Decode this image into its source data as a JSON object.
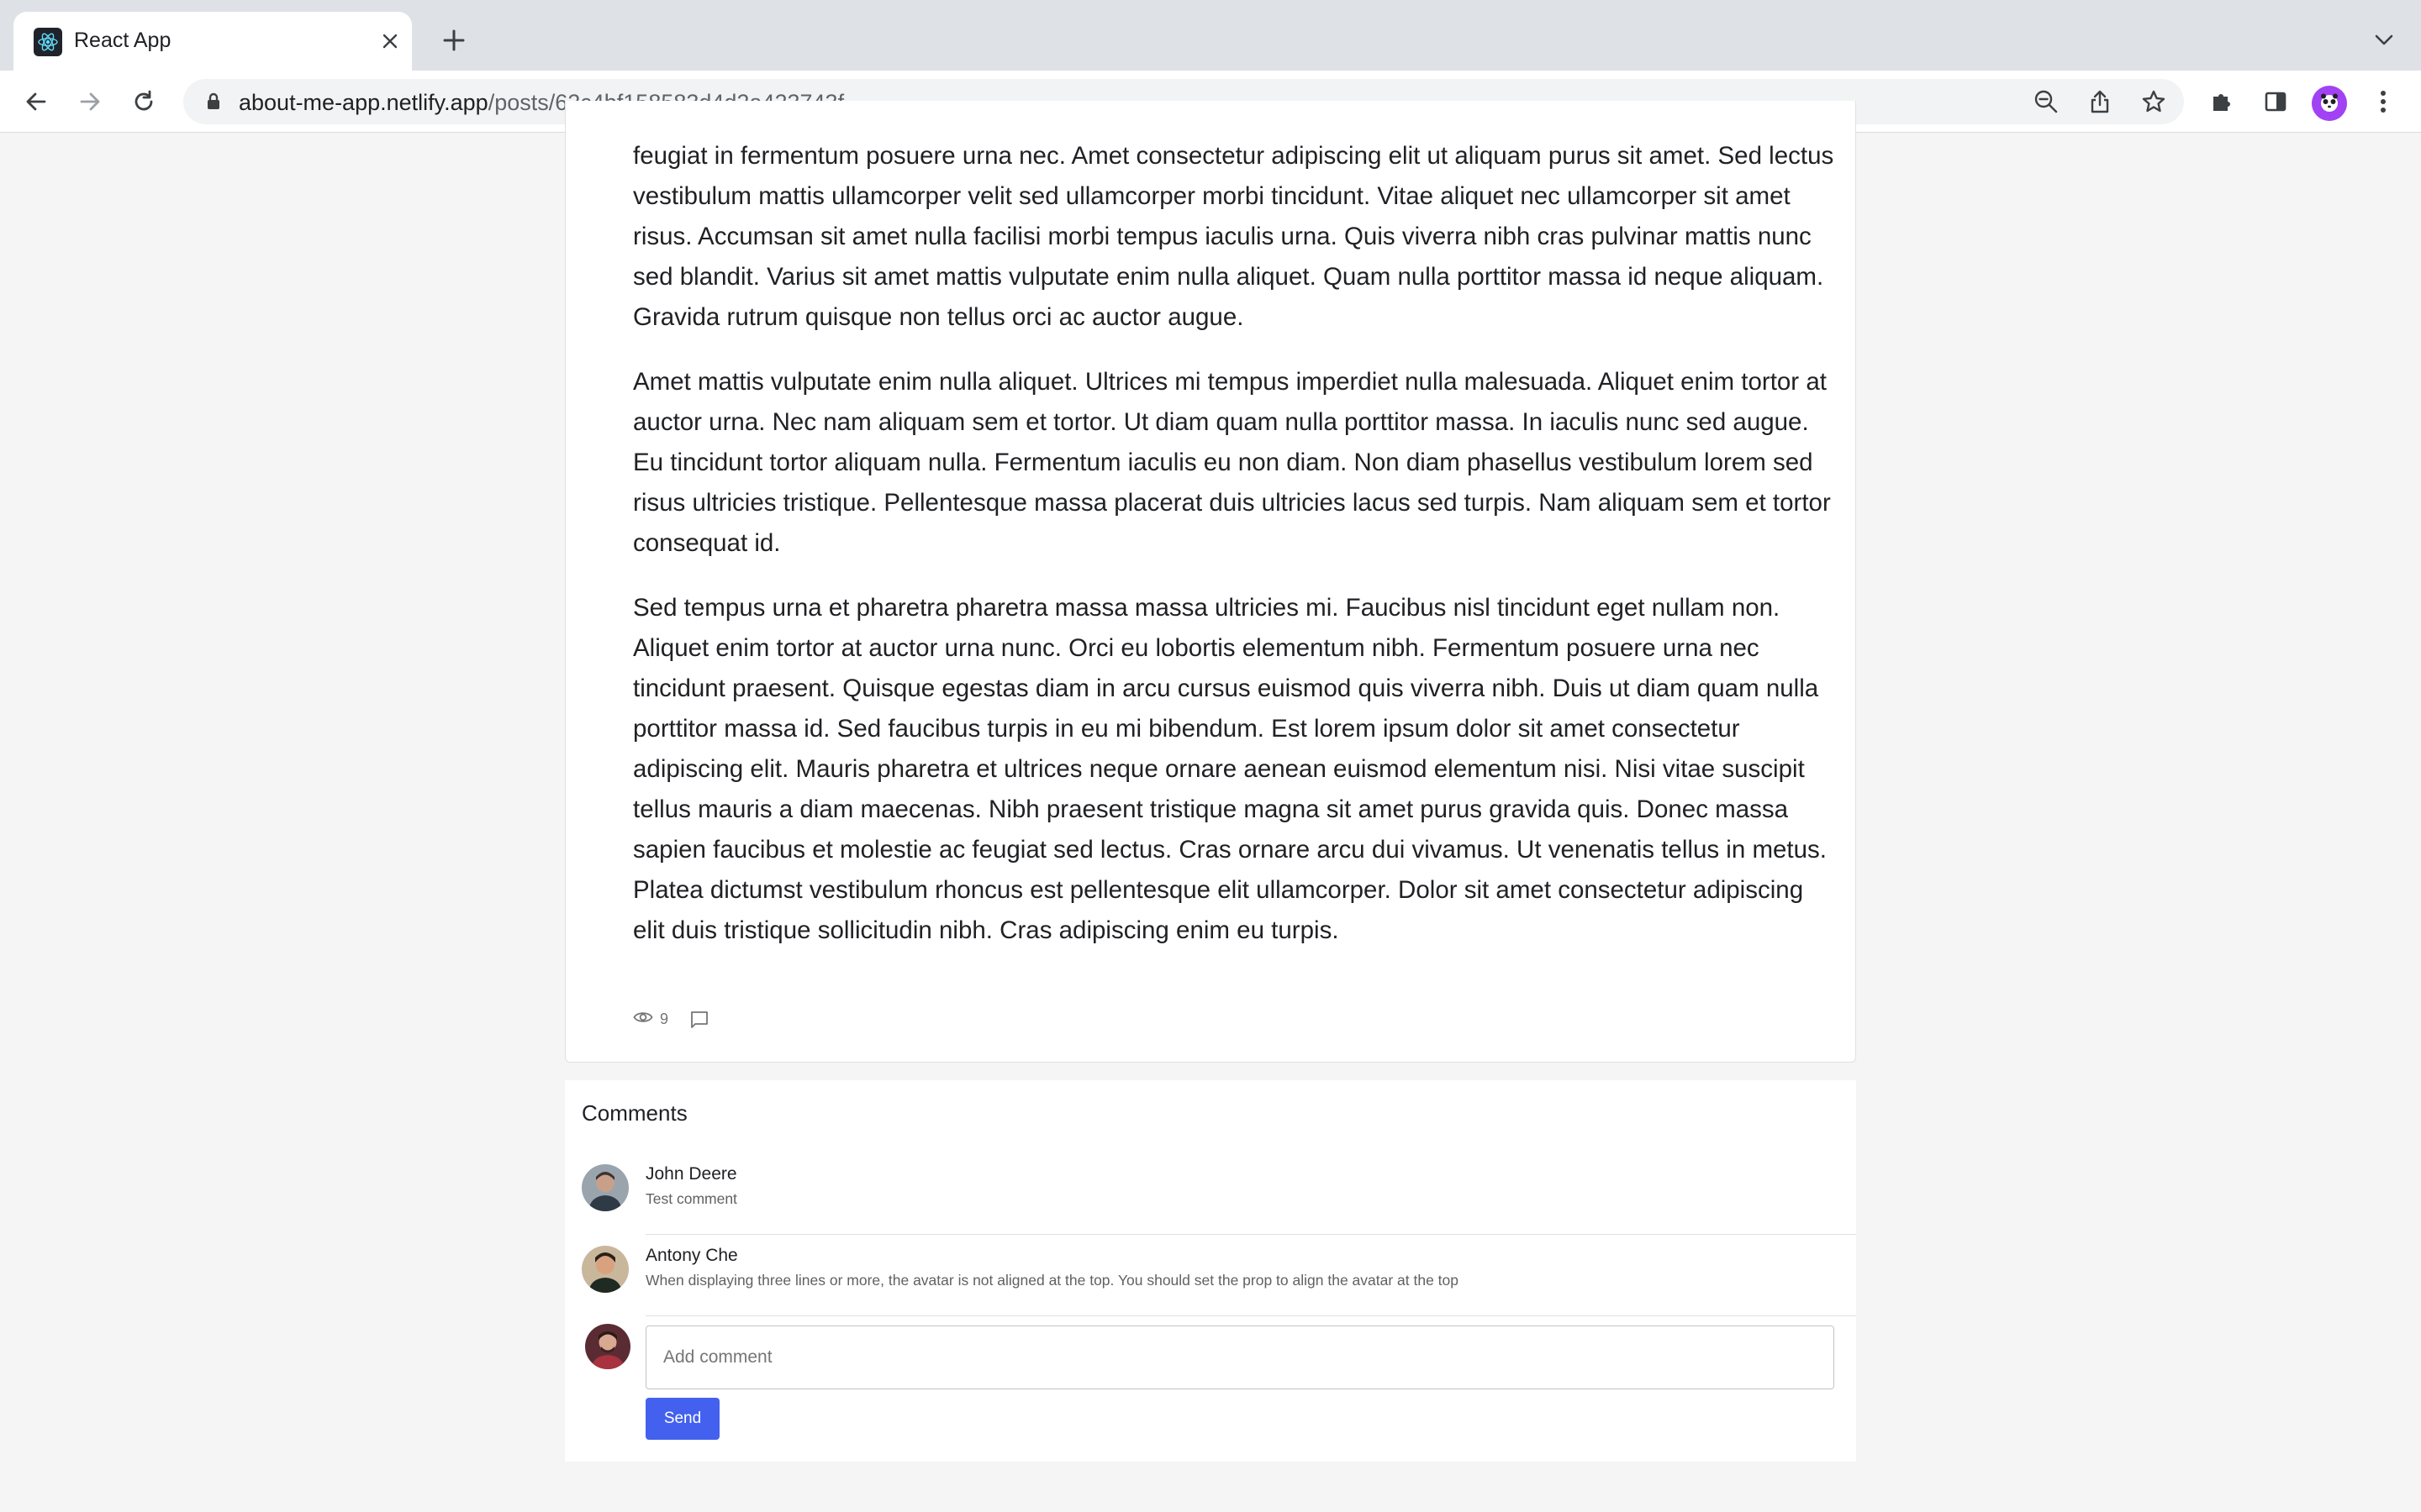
{
  "browser": {
    "tab_title": "React App",
    "url_host": "about-me-app.netlify.app",
    "url_path": "/posts/62c4bf158583d4d2a423743f",
    "accent_color": "#a142f4"
  },
  "post": {
    "paragraphs": [
      "feugiat in fermentum posuere urna nec. Amet consectetur adipiscing elit ut aliquam purus sit amet. Sed lectus vestibulum mattis ullamcorper velit sed ullamcorper morbi tincidunt. Vitae aliquet nec ullamcorper sit amet risus. Accumsan sit amet nulla facilisi morbi tempus iaculis urna. Quis viverra nibh cras pulvinar mattis nunc sed blandit. Varius sit amet mattis vulputate enim nulla aliquet. Quam nulla porttitor massa id neque aliquam. Gravida rutrum quisque non tellus orci ac auctor augue.",
      "Amet mattis vulputate enim nulla aliquet. Ultrices mi tempus imperdiet nulla malesuada. Aliquet enim tortor at auctor urna. Nec nam aliquam sem et tortor. Ut diam quam nulla porttitor massa. In iaculis nunc sed augue. Eu tincidunt tortor aliquam nulla. Fermentum iaculis eu non diam. Non diam phasellus vestibulum lorem sed risus ultricies tristique. Pellentesque massa placerat duis ultricies lacus sed turpis. Nam aliquam sem et tortor consequat id.",
      "Sed tempus urna et pharetra pharetra massa massa ultricies mi. Faucibus nisl tincidunt eget nullam non. Aliquet enim tortor at auctor urna nunc. Orci eu lobortis elementum nibh. Fermentum posuere urna nec tincidunt praesent. Quisque egestas diam in arcu cursus euismod quis viverra nibh. Duis ut diam quam nulla porttitor massa id. Sed faucibus turpis in eu mi bibendum. Est lorem ipsum dolor sit amet consectetur adipiscing elit. Mauris pharetra et ultrices neque ornare aenean euismod elementum nisi. Nisi vitae suscipit tellus mauris a diam maecenas. Nibh praesent tristique magna sit amet purus gravida quis. Donec massa sapien faucibus et molestie ac feugiat sed lectus. Cras ornare arcu dui vivamus. Ut venenatis tellus in metus. Platea dictumst vestibulum rhoncus est pellentesque elit ullamcorper. Dolor sit amet consectetur adipiscing elit duis tristique sollicitudin nibh. Cras adipiscing enim eu turpis."
    ],
    "views": "9",
    "views_icon": "eye-icon",
    "comments_icon": "comment-icon"
  },
  "comments": {
    "title": "Comments",
    "items": [
      {
        "name": "John Deere",
        "text": "Test comment"
      },
      {
        "name": "Antony Che",
        "text": "When displaying three lines or more, the avatar is not aligned at the top. You should set the prop to align the avatar at the top"
      }
    ],
    "input_placeholder": "Add comment",
    "input_value": "",
    "send_label": "Send",
    "send_color": "#4361ee"
  }
}
